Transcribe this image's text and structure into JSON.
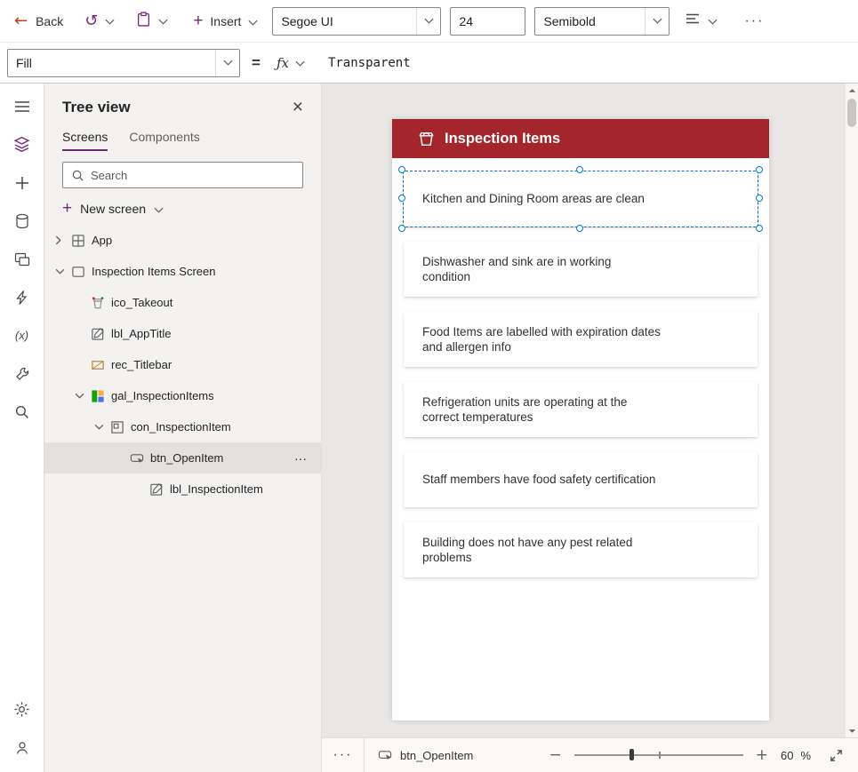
{
  "icons": {
    "back": "←",
    "undo": "↺",
    "plus": "+",
    "more": "···",
    "equals": "=",
    "fx": "ƒx",
    "variables": "(x)",
    "close": "×",
    "minus": "−"
  },
  "toolbar": {
    "back_label": "Back",
    "insert_label": "Insert",
    "font_family": "Segoe UI",
    "font_size": "24",
    "font_weight": "Semibold"
  },
  "formula_bar": {
    "property": "Fill",
    "formula": "Transparent"
  },
  "tree_panel": {
    "title": "Tree view",
    "tabs": [
      {
        "label": "Screens"
      },
      {
        "label": "Components"
      }
    ],
    "search_placeholder": "Search",
    "new_screen_label": "New screen",
    "items": [
      {
        "label": "App"
      },
      {
        "label": "Inspection Items Screen"
      },
      {
        "label": "ico_Takeout"
      },
      {
        "label": "lbl_AppTitle"
      },
      {
        "label": "rec_Titlebar"
      },
      {
        "label": "gal_InspectionItems"
      },
      {
        "label": "con_InspectionItem"
      },
      {
        "label": "btn_OpenItem",
        "selected": true
      },
      {
        "label": "lbl_InspectionItem"
      }
    ]
  },
  "canvas": {
    "app_title": "Inspection Items",
    "cards": [
      {
        "text": "Kitchen and Dining Room areas are clean",
        "selected": true
      },
      {
        "text": "Dishwasher and sink are in working condition"
      },
      {
        "text": "Food Items are labelled with expiration dates and allergen info"
      },
      {
        "text": "Refrigeration units are operating at the correct temperatures"
      },
      {
        "text": "Staff members have food safety certification"
      },
      {
        "text": "Building does not have any pest related problems"
      }
    ]
  },
  "status_bar": {
    "selected_control": "btn_OpenItem",
    "zoom_value": "60",
    "zoom_unit": "%"
  },
  "colors": {
    "accent": "#742774",
    "selection": "#0078d4",
    "titlebar_red": "#a4262c"
  }
}
